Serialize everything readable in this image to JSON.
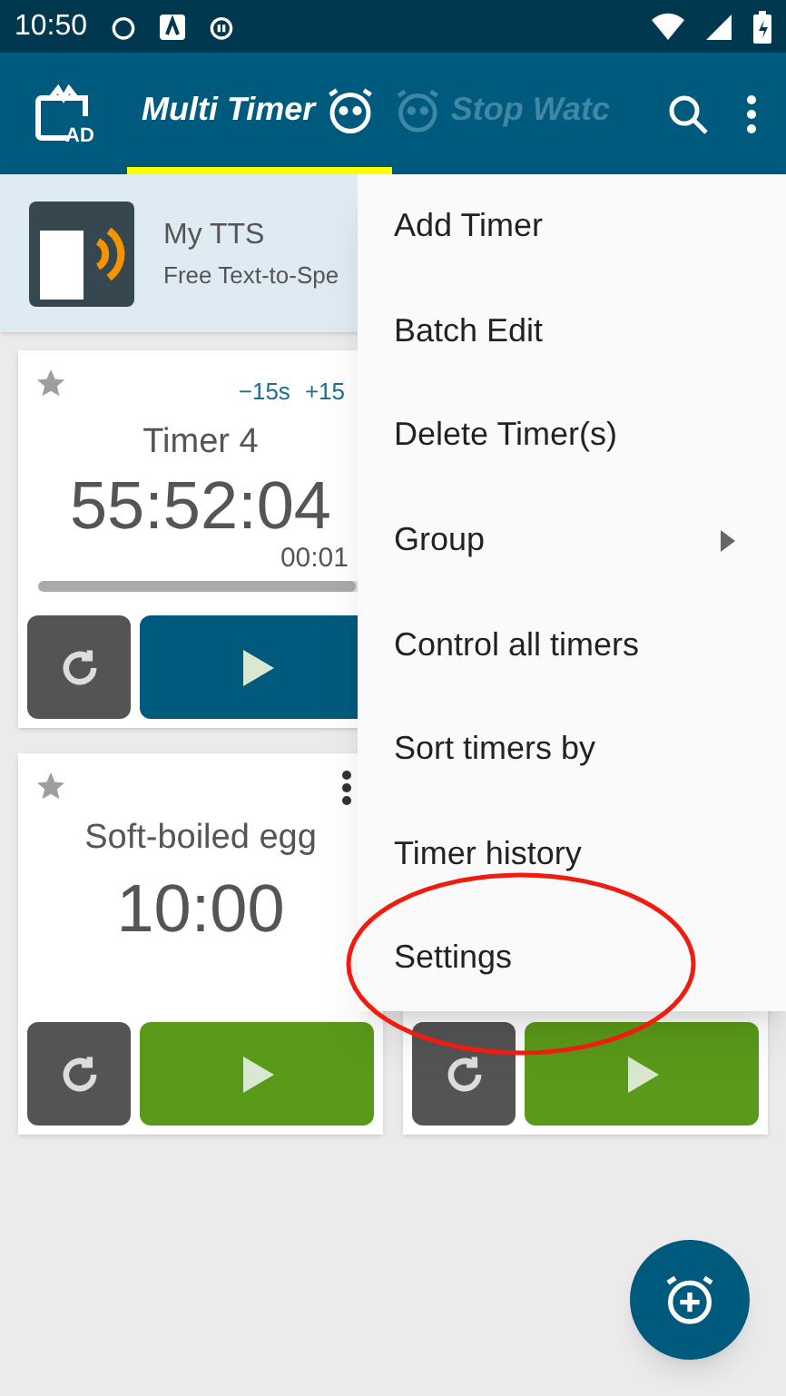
{
  "status_bar": {
    "time": "10:50"
  },
  "app_bar": {
    "ad_label": "AD",
    "tabs": [
      {
        "label": "Multi Timer",
        "selected": true
      },
      {
        "label": "Stop Watc",
        "selected": false
      }
    ]
  },
  "ad_banner": {
    "title": "My TTS",
    "subtitle": "Free Text-to-Spe"
  },
  "timers": [
    {
      "kind": "running",
      "adjust": [
        "−15s",
        "+15"
      ],
      "name": "Timer 4",
      "time": "55:52:04",
      "elapsed": "00:01",
      "starred": false,
      "level": 0.98,
      "color": "#005a7d"
    },
    {
      "kind": "idle",
      "name": "Soft-boiled egg",
      "time": "10:00",
      "starred": false,
      "color": "#5a9a1a"
    }
  ],
  "hidden_timer": {
    "color": "#5a9a1a"
  },
  "menu": {
    "items": [
      {
        "label": "Add Timer",
        "submenu": false
      },
      {
        "label": "Batch Edit",
        "submenu": false
      },
      {
        "label": "Delete Timer(s)",
        "submenu": false
      },
      {
        "label": "Group",
        "submenu": true
      },
      {
        "label": "Control all timers",
        "submenu": false
      },
      {
        "label": "Sort timers by",
        "submenu": false
      },
      {
        "label": "Timer history",
        "submenu": false
      },
      {
        "label": "Settings",
        "submenu": false,
        "circled": true
      }
    ]
  }
}
